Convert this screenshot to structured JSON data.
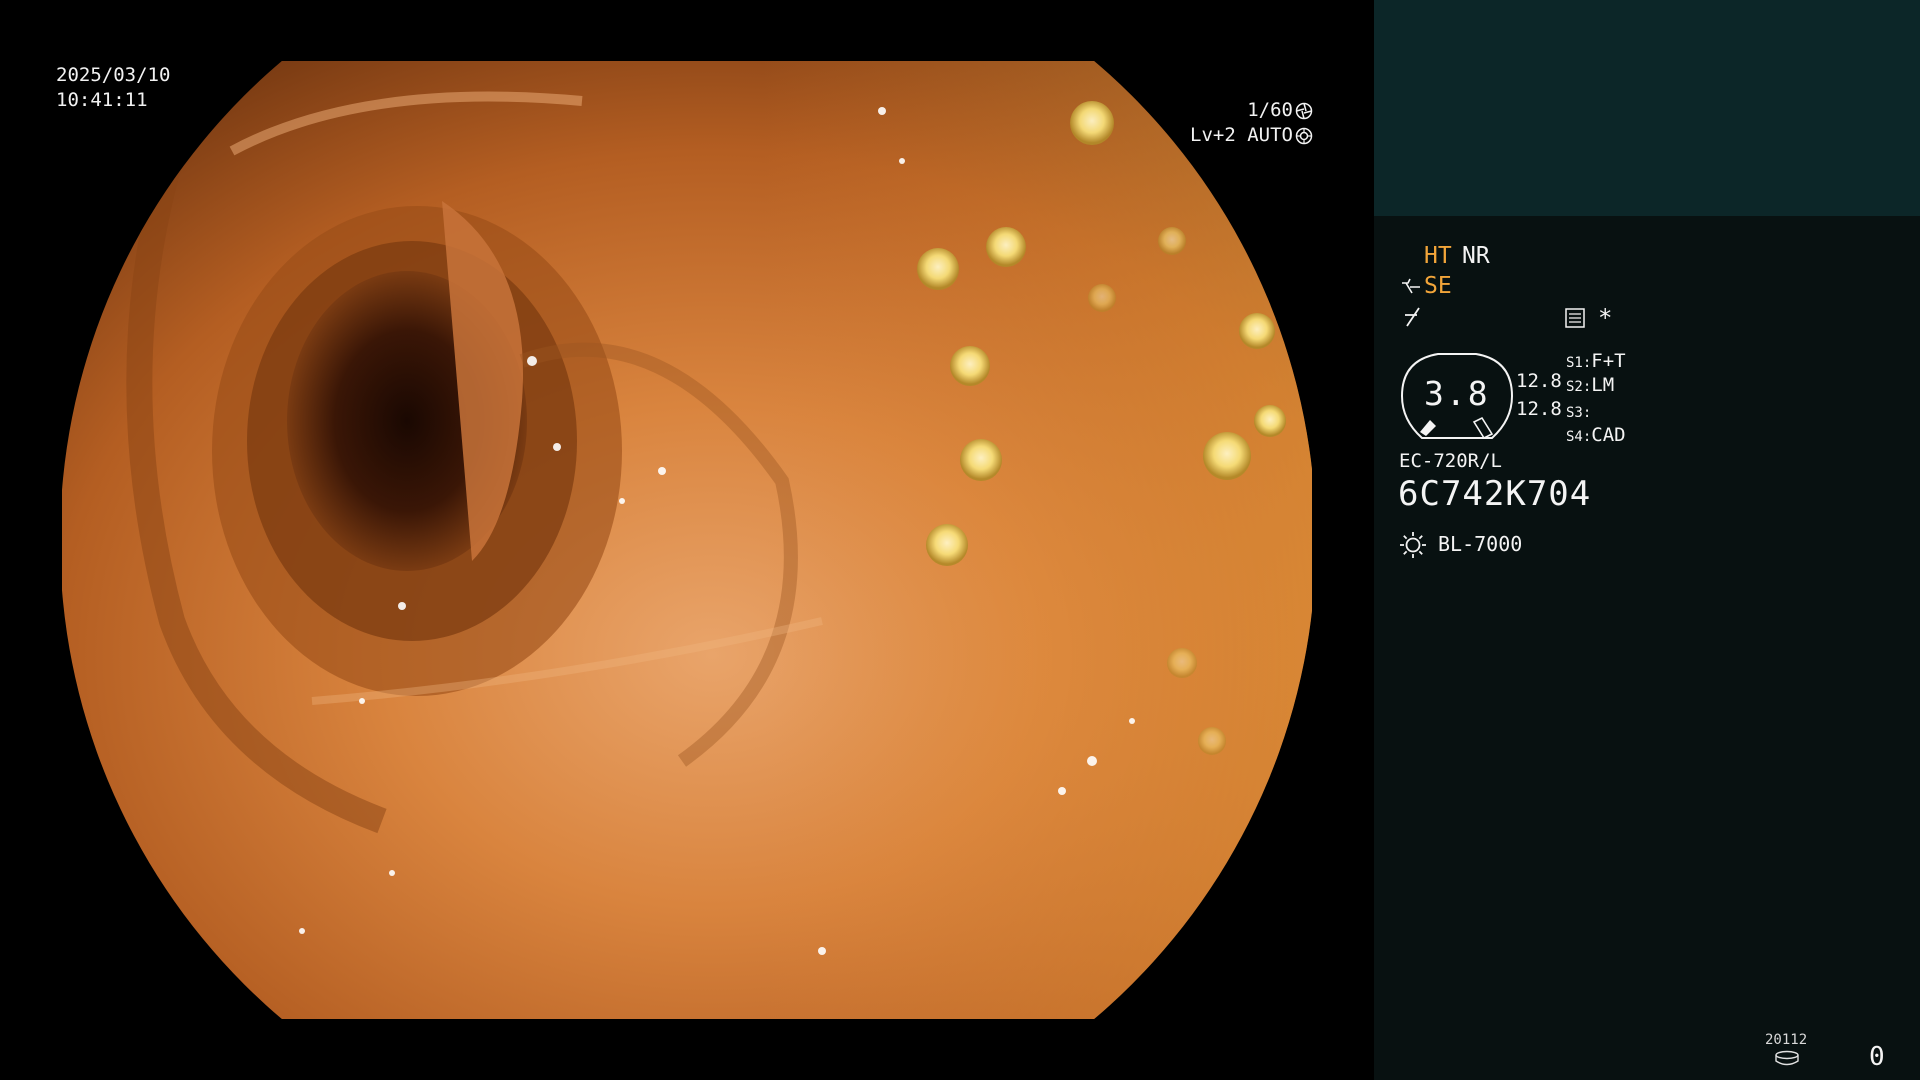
{
  "overlay": {
    "date": "2025/03/10",
    "time": "10:41:11",
    "shutter": "1/60",
    "shutter_icon": "shutter-icon",
    "iris": "Lv+2 AUTO",
    "iris_icon": "iris-icon"
  },
  "panel": {
    "mode_ht": "HT",
    "mode_nr": "NR",
    "mode_se": "SE",
    "se_icon": "enhancement-icon",
    "f_icon": "freeze-icon",
    "menu_icon": "menu-icon",
    "asterisk": "*",
    "gauge_value": "3.8",
    "value_1": "12.8",
    "value_2": "12.8",
    "slots": [
      {
        "label": "S1:",
        "value": "F+T"
      },
      {
        "label": "S2:",
        "value": "LM"
      },
      {
        "label": "S3:",
        "value": ""
      },
      {
        "label": "S4:",
        "value": "CAD"
      }
    ],
    "scope_model": "EC-720R/L",
    "scope_serial": "6C742K704",
    "light_icon": "light-source-icon",
    "light_source": "BL-7000",
    "counter_label": "20112",
    "counter_icon": "disk-icon",
    "counter_value": "0"
  },
  "colors": {
    "panel_top": "#0c2628",
    "panel_bottom": "#081111",
    "accent_orange": "#f2a53a",
    "text": "#f4f4f4"
  }
}
